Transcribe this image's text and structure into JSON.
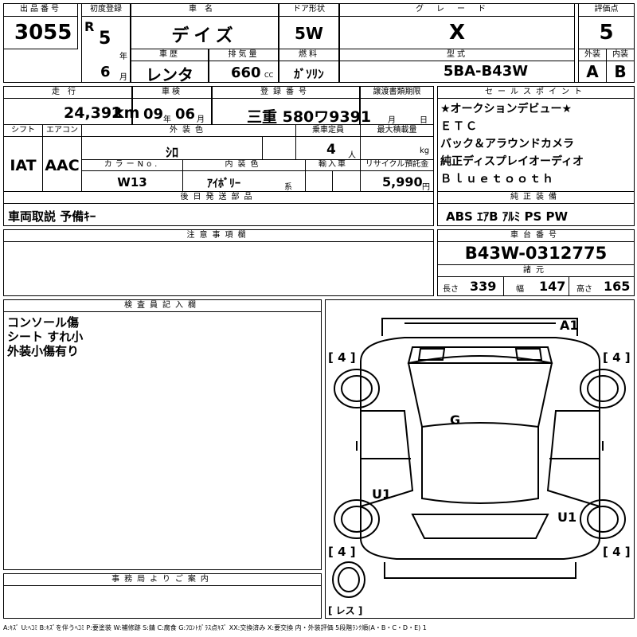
{
  "labels": {
    "lot": "出品番号",
    "first_reg": "初度登録",
    "car_name": "車名",
    "door": "ドア形状",
    "grade": "グレード",
    "score": "評価点",
    "era": "R",
    "year_unit": "年",
    "month_unit": "月",
    "history": "車歴",
    "displacement": "排気量",
    "fuel": "燃料",
    "model": "型式",
    "exterior": "外装",
    "interior": "内装",
    "mileage": "走行",
    "inspection": "車検",
    "reg_no": "登録番号",
    "transfer": "譲渡書類期限",
    "sales_points": "セールスポイント",
    "shift": "シフト",
    "aircon": "エアコン",
    "ext_color": "外装色",
    "capacity": "乗車定員",
    "max_load": "最大積載量",
    "color_no": "カラーNo.",
    "int_color": "内装色",
    "import": "輸入車",
    "recycle": "リサイクル預託金",
    "later_parts": "後日発送部品",
    "std_equip": "純正装備",
    "notes": "注意事項欄",
    "chassis_no": "車台番号",
    "dimensions": "諸元",
    "inspector": "検査員記入欄",
    "office": "事務局よりご案内",
    "km": "km",
    "nen": "年",
    "tsuki": "月",
    "cc": "CC",
    "hi": "日",
    "nin": "人",
    "kg": "kg",
    "kei": "系",
    "length": "長さ",
    "width": "幅",
    "height": "高さ"
  },
  "values": {
    "lot_no": "3055",
    "year": "5",
    "month": "6",
    "car_name": "デイズ",
    "door": "5W",
    "grade": "X",
    "score": "5",
    "history": "レンタ",
    "displacement": "660",
    "fuel": "ｶﾞｿﾘﾝ",
    "model": "5BA-B43W",
    "exterior": "A",
    "interior": "B",
    "mileage": "24,392",
    "insp_year": "09",
    "insp_month": "06",
    "reg_no": "三重 580ワ9391",
    "shift": "IAT",
    "aircon": "AAC",
    "ext_color": "ｼﾛ",
    "capacity": "4",
    "color_no": "W13",
    "int_color": "ｱｲﾎﾞﾘｰ",
    "recycle": "5,990",
    "recycle_unit": "円",
    "later_parts": "車両取説 予備ｷｰ",
    "std_equip": "ABS ｴｱB ｱﾙﾐ PS PW",
    "chassis_no": "B43W-0312775",
    "length": "339",
    "width": "147",
    "height": "165",
    "inspector_notes": [
      "コンソール傷",
      "シート すれ小",
      "外装小傷有り"
    ]
  },
  "sales_points": [
    "★オークションデビュー★",
    "ＥＴＣ",
    "バック＆アラウンドカメラ",
    "純正ディスプレイオーディオ",
    "Ｂｌｕｅｔｏｏｔｈ"
  ],
  "diagram": {
    "tires": [
      "4",
      "4",
      "4",
      "4"
    ],
    "spare_label": "[ レス ]",
    "marks": {
      "a1": "A1",
      "g": "G",
      "u1_left": "U1",
      "u1_right": "U1"
    }
  },
  "legend": "A:ｷｽﾞ U:ﾍｺﾐ B:ｷｽﾞを伴うﾍｺﾐ P:要塗装 W:補修跡 S:錆 C:腐食 G:ﾌﾛﾝﾄｶﾞﾗｽ点ｷｽﾞ XX:交換済み X:要交換 内・外装評価 5段階ﾗﾝｸ順(A・B・C・D・E) 1"
}
